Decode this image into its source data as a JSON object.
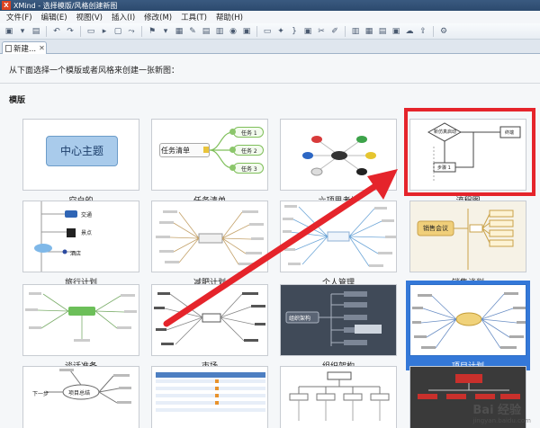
{
  "window": {
    "title": "XMind - 选择模版/风格创建新图",
    "logo_text": "X"
  },
  "menu": [
    "文件(F)",
    "编辑(E)",
    "视图(V)",
    "插入(I)",
    "修改(M)",
    "工具(T)",
    "帮助(H)"
  ],
  "tab": {
    "label": "新建...",
    "close": "✕"
  },
  "instruction": "从下面选择一个模版或者风格来创建一张新图：",
  "section_title": "模版",
  "templates": [
    {
      "label": "空白的",
      "central": "中心主题"
    },
    {
      "label": "任务清单",
      "central": "任务清单",
      "tasks": [
        "任务 1",
        "任务 2",
        "任务 3"
      ]
    },
    {
      "label": "六顶思考帽"
    },
    {
      "label": "流程图",
      "nodes": [
        "新仿真启动",
        "终端",
        "步骤 1"
      ]
    },
    {
      "label": "旅行计划",
      "tags": [
        "交通",
        "景点",
        "酒店"
      ]
    },
    {
      "label": "减肥计划"
    },
    {
      "label": "个人管理"
    },
    {
      "label": "销售谈判",
      "central": "销售会议"
    },
    {
      "label": "谈话准备"
    },
    {
      "label": "市场"
    },
    {
      "label": "组织架构",
      "central": "组织架构"
    },
    {
      "label": "项目计划",
      "selected": true
    },
    {
      "label": "",
      "central": "项目总结",
      "side": "下一步"
    },
    {
      "label": ""
    },
    {
      "label": ""
    },
    {
      "label": ""
    }
  ],
  "watermark": {
    "main": "Bai 经验",
    "sub": "jingyan.baidu.com"
  },
  "colors": {
    "highlight": "#e5242b",
    "selection": "#3478d8"
  }
}
